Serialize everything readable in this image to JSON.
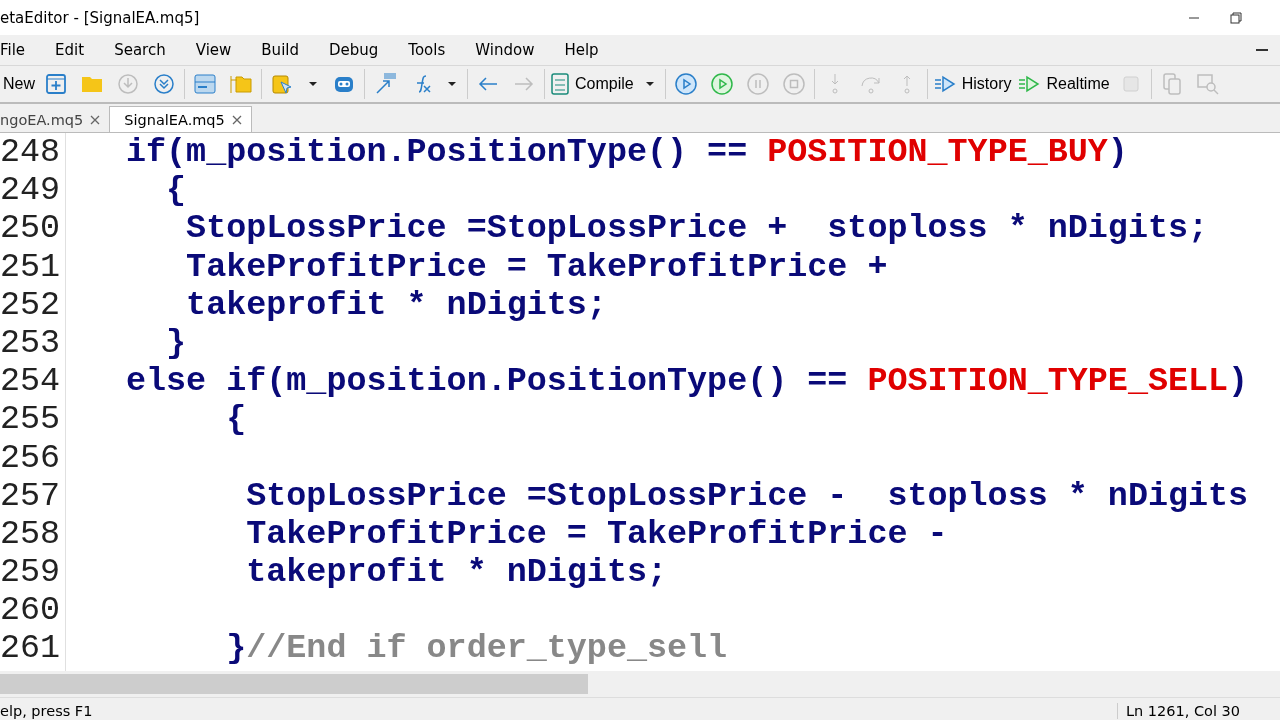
{
  "window": {
    "title": "etaEditor - [SignalEA.mq5]"
  },
  "menu": [
    "File",
    "Edit",
    "Search",
    "View",
    "Build",
    "Debug",
    "Tools",
    "Window",
    "Help"
  ],
  "toolbar": {
    "new": "New",
    "compile": "Compile",
    "history": "History",
    "realtime": "Realtime"
  },
  "tabs": [
    {
      "label": "ngoEA.mq5",
      "selected": false
    },
    {
      "label": "SignalEA.mq5",
      "selected": true
    }
  ],
  "editor": {
    "lines": [
      {
        "number": "248",
        "tokens": [
          {
            "kind": "code",
            "text": "if(m_position.PositionType() == "
          },
          {
            "kind": "constant",
            "text": "POSITION_TYPE_BUY"
          },
          {
            "kind": "code",
            "text": ")"
          }
        ]
      },
      {
        "number": "249",
        "tokens": [
          {
            "kind": "code",
            "text": "  {"
          }
        ]
      },
      {
        "number": "250",
        "tokens": [
          {
            "kind": "code",
            "text": "   StopLossPrice =StopLossPrice +  stoploss * nDigits;"
          }
        ]
      },
      {
        "number": "251",
        "tokens": [
          {
            "kind": "code",
            "text": "   TakeProfitPrice = TakeProfitPrice +"
          }
        ]
      },
      {
        "number": "252",
        "tokens": [
          {
            "kind": "code",
            "text": "   takeprofit * nDigits;"
          }
        ]
      },
      {
        "number": "253",
        "tokens": [
          {
            "kind": "code",
            "text": "  }"
          }
        ]
      },
      {
        "number": "254",
        "tokens": [
          {
            "kind": "code",
            "text": "else if(m_position.PositionType() == "
          },
          {
            "kind": "constant",
            "text": "POSITION_TYPE_SELL"
          },
          {
            "kind": "code",
            "text": ")"
          }
        ]
      },
      {
        "number": "255",
        "tokens": [
          {
            "kind": "code",
            "text": "     {"
          }
        ]
      },
      {
        "number": "256"
      },
      {
        "number": "257",
        "tokens": [
          {
            "kind": "code",
            "text": "      StopLossPrice =StopLossPrice -  stoploss * nDigits"
          }
        ]
      },
      {
        "number": "258",
        "tokens": [
          {
            "kind": "code",
            "text": "      TakeProfitPrice = TakeProfitPrice -"
          }
        ]
      },
      {
        "number": "259",
        "tokens": [
          {
            "kind": "code",
            "text": "      takeprofit * nDigits;"
          }
        ]
      },
      {
        "number": "260"
      },
      {
        "number": "261",
        "tokens": [
          {
            "kind": "code",
            "text": "     }"
          },
          {
            "kind": "comment",
            "text": "//End if order_type_sell"
          }
        ]
      }
    ]
  },
  "status_bar": {
    "help": "elp, press F1",
    "position": "Ln 1261, Col 30"
  }
}
